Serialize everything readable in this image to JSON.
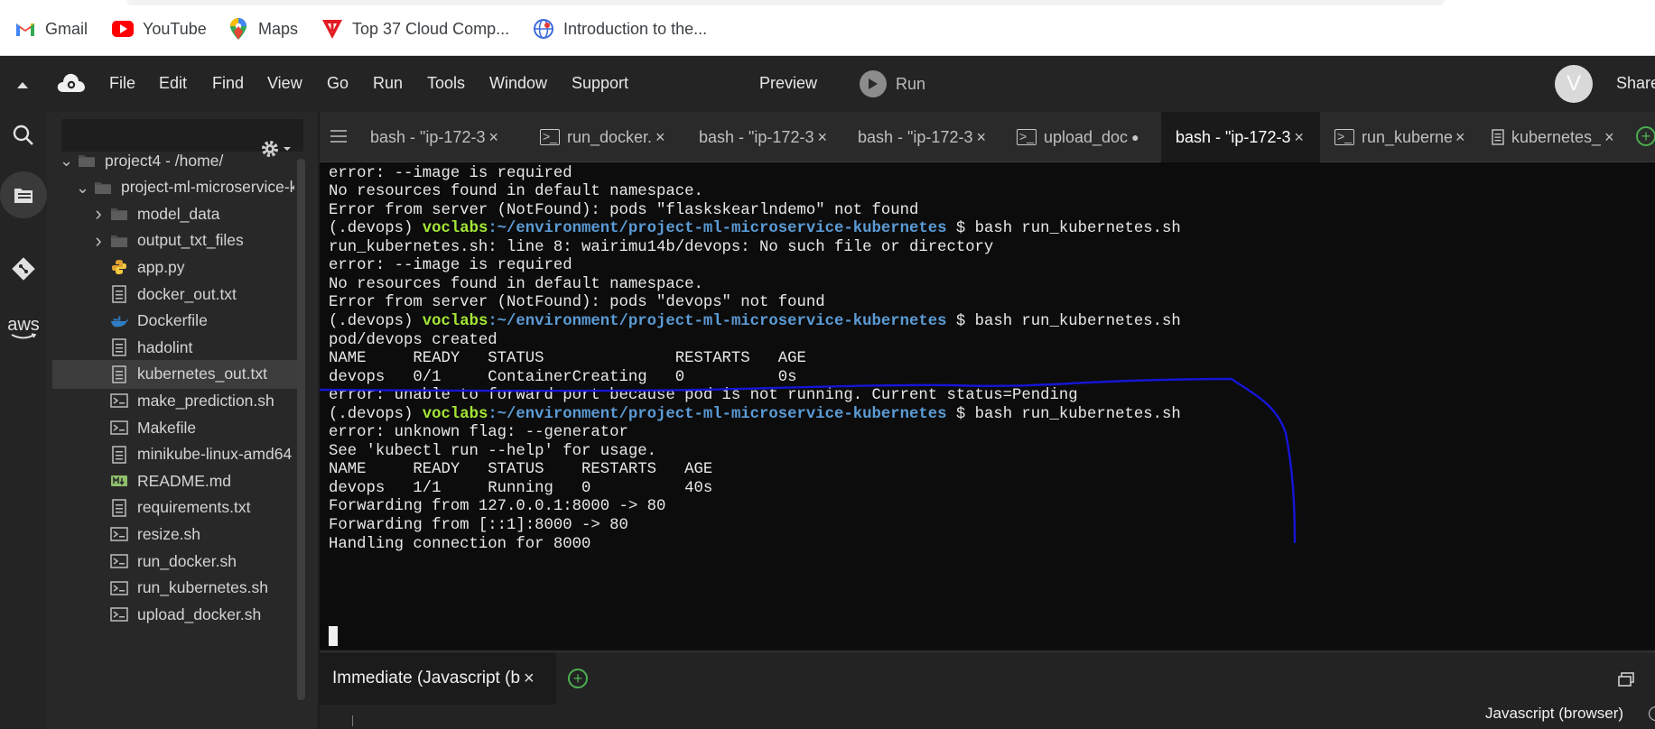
{
  "bookmarks": [
    {
      "label": "Gmail",
      "icon": "gmail-icon"
    },
    {
      "label": "YouTube",
      "icon": "youtube-icon"
    },
    {
      "label": "Maps",
      "icon": "maps-icon"
    },
    {
      "label": "Top 37 Cloud Comp...",
      "icon": "top37-icon"
    },
    {
      "label": "Introduction to the...",
      "icon": "globe-icon"
    }
  ],
  "menu": {
    "items": [
      "File",
      "Edit",
      "Find",
      "View",
      "Go",
      "Run",
      "Tools",
      "Window",
      "Support"
    ],
    "preview": "Preview",
    "run": "Run",
    "avatar": "V",
    "share": "Share"
  },
  "activity": [
    "search-icon",
    "files-icon",
    "git-icon",
    "aws-icon"
  ],
  "aws_label": "aws",
  "tree": [
    {
      "label": "project4 - /home/",
      "type": "folder",
      "open": true
    },
    {
      "label": "project-ml-microservice-kubernetes",
      "type": "folder",
      "open": true
    },
    {
      "label": "model_data",
      "type": "folder",
      "open": false
    },
    {
      "label": "output_txt_files",
      "type": "folder",
      "open": false
    },
    {
      "label": "app.py",
      "type": "python"
    },
    {
      "label": "docker_out.txt",
      "type": "text"
    },
    {
      "label": "Dockerfile",
      "type": "docker"
    },
    {
      "label": "hadolint",
      "type": "text"
    },
    {
      "label": "kubernetes_out.txt",
      "type": "text",
      "selected": true
    },
    {
      "label": "make_prediction.sh",
      "type": "shell"
    },
    {
      "label": "Makefile",
      "type": "shell"
    },
    {
      "label": "minikube-linux-amd64",
      "type": "text"
    },
    {
      "label": "README.md",
      "type": "markdown"
    },
    {
      "label": "requirements.txt",
      "type": "text"
    },
    {
      "label": "resize.sh",
      "type": "shell"
    },
    {
      "label": "run_docker.sh",
      "type": "shell"
    },
    {
      "label": "run_kubernetes.sh",
      "type": "shell"
    },
    {
      "label": "upload_docker.sh",
      "type": "shell"
    }
  ],
  "tabs": [
    {
      "label": "bash - \"ip-172-3",
      "icon": "",
      "close": "×"
    },
    {
      "label": "run_docker.",
      "icon": ">_",
      "close": "×"
    },
    {
      "label": "bash - \"ip-172-3",
      "icon": "",
      "close": "×"
    },
    {
      "label": "bash - \"ip-172-3",
      "icon": "",
      "close": "×"
    },
    {
      "label": "upload_doc",
      "icon": ">_",
      "close": "●"
    },
    {
      "label": "bash - \"ip-172-3",
      "icon": "",
      "close": "×",
      "active": true
    },
    {
      "label": "run_kuberne",
      "icon": ">_",
      "close": "×"
    },
    {
      "label": "kubernetes_",
      "icon": "doc",
      "close": "×"
    }
  ],
  "terminal": {
    "prompt_venv": "(.devops) ",
    "prompt_user": "voclabs",
    "prompt_path": ":~/environment/project-ml-microservice-kubernetes",
    "prompt_cmd": " $ bash run_kubernetes.sh",
    "lines": [
      {
        "type": "text",
        "text": "error: --image is required"
      },
      {
        "type": "text",
        "text": "No resources found in default namespace."
      },
      {
        "type": "text",
        "text": "Error from server (NotFound): pods \"flaskskearlndemo\" not found"
      },
      {
        "type": "prompt"
      },
      {
        "type": "text",
        "text": "run_kubernetes.sh: line 8: wairimu14b/devops: No such file or directory"
      },
      {
        "type": "text",
        "text": "error: --image is required"
      },
      {
        "type": "text",
        "text": "No resources found in default namespace."
      },
      {
        "type": "text",
        "text": "Error from server (NotFound): pods \"devops\" not found"
      },
      {
        "type": "prompt"
      },
      {
        "type": "text",
        "text": "pod/devops created"
      },
      {
        "type": "text",
        "text": "NAME     READY   STATUS              RESTARTS   AGE"
      },
      {
        "type": "text",
        "text": "devops   0/1     ContainerCreating   0          0s"
      },
      {
        "type": "text",
        "text": "error: unable to forward port because pod is not running. Current status=Pending"
      },
      {
        "type": "prompt"
      },
      {
        "type": "text",
        "text": "error: unknown flag: --generator"
      },
      {
        "type": "text",
        "text": "See 'kubectl run --help' for usage."
      },
      {
        "type": "text",
        "text": "NAME     READY   STATUS    RESTARTS   AGE"
      },
      {
        "type": "text",
        "text": "devops   1/1     Running   0          40s"
      },
      {
        "type": "text",
        "text": "Forwarding from 127.0.0.1:8000 -> 80"
      },
      {
        "type": "text",
        "text": "Forwarding from [::1]:8000 -> 80"
      },
      {
        "type": "text",
        "text": "Handling connection for 8000"
      }
    ]
  },
  "bottom": {
    "tab_label": "Immediate (Javascript (browser))",
    "tab_close": "×",
    "mode": "Javascript (browser)"
  }
}
